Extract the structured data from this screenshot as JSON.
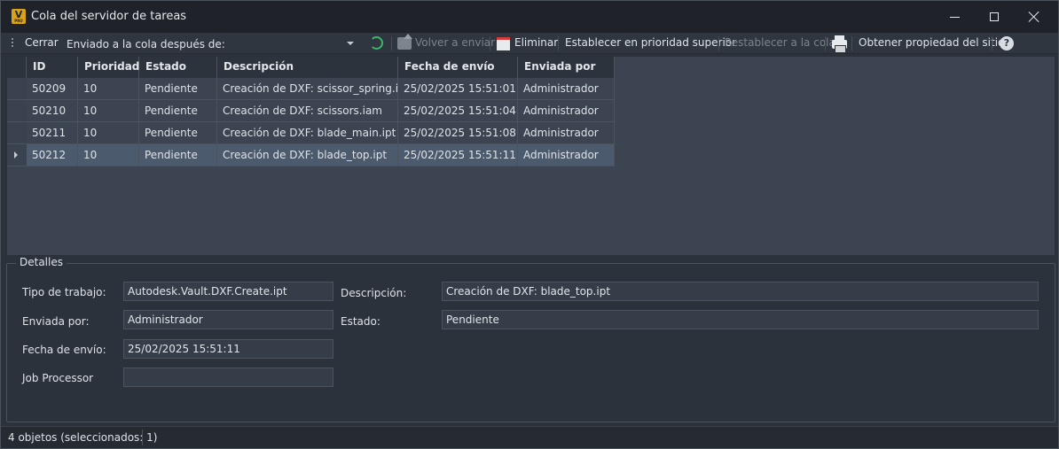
{
  "window": {
    "title": "Cola del servidor de tareas",
    "logo_letter": "V",
    "logo_sub": "PRO"
  },
  "toolbar": {
    "close_label": "Cerrar",
    "queue_filter_value": "Enviado a la cola después de:",
    "resend_label": "Volver a enviar",
    "delete_label": "Eliminar",
    "set_priority_label": "Establecer en prioridad superior",
    "reset_queue_label": "Restablecer a la cola",
    "site_property_label": "Obtener propiedad del sitio",
    "help_glyph": "?"
  },
  "grid": {
    "columns": [
      "ID",
      "Prioridad",
      "Estado",
      "Descripción",
      "Fecha de envío",
      "Enviada por"
    ],
    "rows": [
      [
        "50209",
        "10",
        "Pendiente",
        "Creación de DXF: scissor_spring.ipt",
        "25/02/2025 15:51:01",
        "Administrador"
      ],
      [
        "50210",
        "10",
        "Pendiente",
        "Creación de DXF: scissors.iam",
        "25/02/2025 15:51:04",
        "Administrador"
      ],
      [
        "50211",
        "10",
        "Pendiente",
        "Creación de DXF: blade_main.ipt",
        "25/02/2025 15:51:08",
        "Administrador"
      ],
      [
        "50212",
        "10",
        "Pendiente",
        "Creación de DXF: blade_top.ipt",
        "25/02/2025 15:51:11",
        "Administrador"
      ]
    ],
    "selected_row": 3
  },
  "details": {
    "legend": "Detalles",
    "job_type_label": "Tipo de trabajo:",
    "job_type_value": "Autodesk.Vault.DXF.Create.ipt",
    "description_label": "Descripción:",
    "description_value": "Creación de DXF: blade_top.ipt",
    "submitted_by_label": "Enviada por:",
    "submitted_by_value": "Administrador",
    "status_label": "Estado:",
    "status_value": "Pendiente",
    "submit_date_label": "Fecha de envío:",
    "submit_date_value": "25/02/2025 15:51:11",
    "job_processor_label": "Job Processor",
    "job_processor_value": ""
  },
  "status": {
    "count_text": "4 objetos (seleccionados: 1)"
  }
}
